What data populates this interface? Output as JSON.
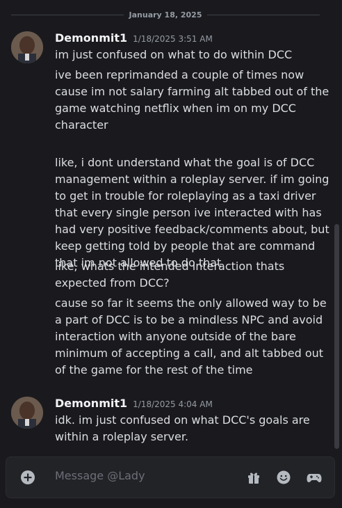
{
  "date_divider": "January 18, 2025",
  "groups": [
    {
      "username": "Demonmit1",
      "timestamp": "1/18/2025 3:51 AM",
      "messages": [
        "im just confused on what to do within DCC",
        "ive been reprimanded a couple of times now cause im not salary farming alt tabbed out of the game watching netflix when im on my DCC character",
        "like, i dont understand what the goal is of DCC management within a roleplay server. if im going to get in trouble for roleplaying as a taxi driver that every single person ive interacted with has had very positive feedback/comments about, but keep getting told by people that are command that im not allowed to do that",
        "like, whats the intended interaction thats expected from DCC?",
        "cause so far it seems the only allowed way to be a part of DCC is to be a mindless NPC and avoid interaction with anyone outside of the bare minimum of accepting a call, and alt tabbed out of the game for the rest of the time"
      ]
    },
    {
      "username": "Demonmit1",
      "timestamp": "1/18/2025 4:04 AM",
      "messages": [
        "idk. im just confused on what DCC's goals are within a roleplay server."
      ]
    }
  ],
  "composer": {
    "placeholder": "Message @Lady",
    "icons": [
      "plus-circle-icon",
      "gift-icon",
      "emoji-icon",
      "gamepad-icon"
    ]
  },
  "colors": {
    "background": "#1a1a1e",
    "text": "#dbdee1",
    "username": "#f2f3f5",
    "muted": "#949ba4",
    "composer_bg": "#222327"
  }
}
